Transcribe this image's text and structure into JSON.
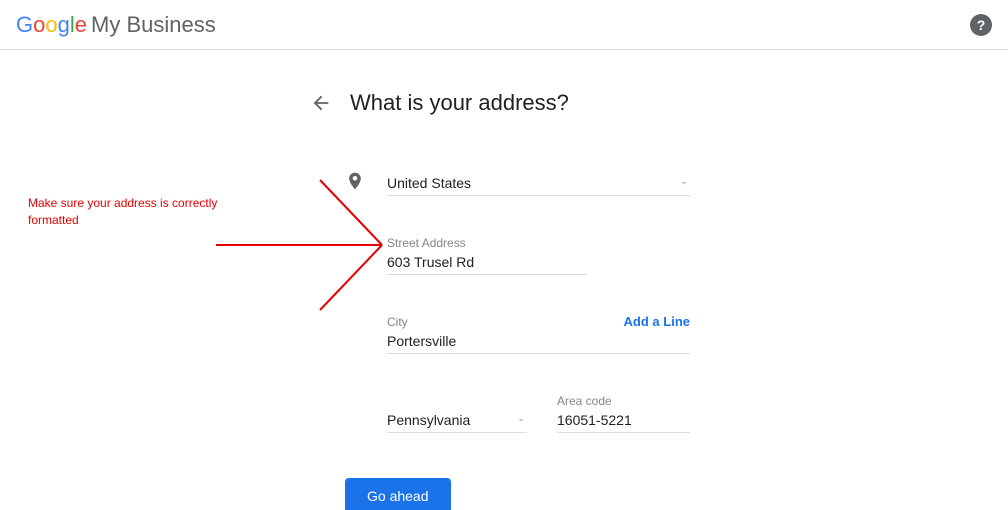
{
  "header": {
    "product_name": "My Business"
  },
  "page": {
    "title": "What is your address?"
  },
  "form": {
    "country": "United States",
    "street_label": "Street Address",
    "street_value": "603 Trusel Rd",
    "add_line": "Add a Line",
    "city_label": "City",
    "city_value": "Portersville",
    "state_value": "Pennsylvania",
    "zip_label": "Area code",
    "zip_value": "16051-5221"
  },
  "cta": {
    "go": "Go ahead"
  },
  "annotation": {
    "text": "Make sure your address is correctly formatted"
  }
}
